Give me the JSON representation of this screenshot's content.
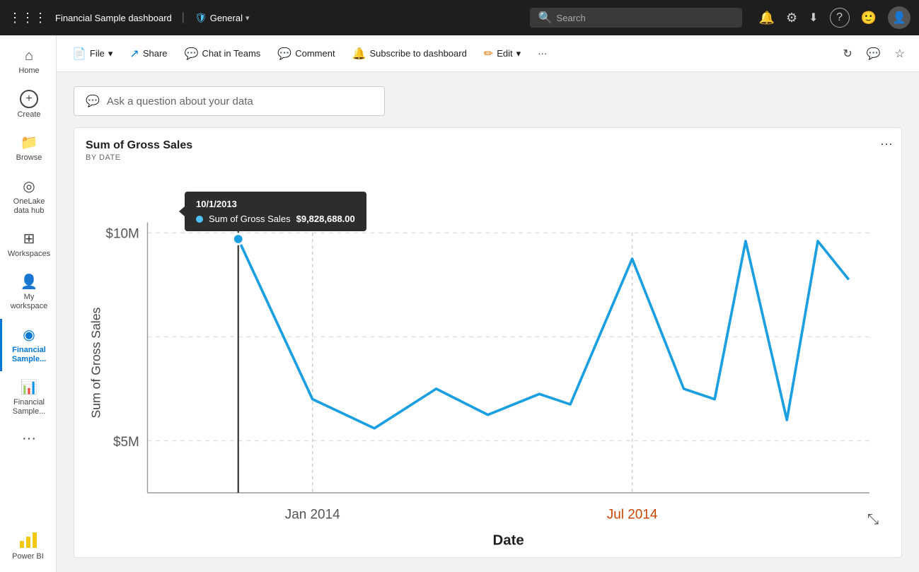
{
  "topnav": {
    "waffle": "⠿",
    "app_title": "Financial Sample  dashboard",
    "divider": "|",
    "workspace": "General",
    "search_placeholder": "Search",
    "icons": {
      "bell": "🔔",
      "gear": "⚙",
      "download": "⬇",
      "help": "?",
      "feedback": "🙂"
    }
  },
  "toolbar": {
    "file_label": "File",
    "share_label": "Share",
    "chat_label": "Chat in Teams",
    "comment_label": "Comment",
    "subscribe_label": "Subscribe to dashboard",
    "edit_label": "Edit",
    "more_label": "···",
    "refresh_label": "↻",
    "chat_icon_label": "💬",
    "star_label": "☆"
  },
  "qa": {
    "placeholder": "Ask a question about your data"
  },
  "chart": {
    "title": "Sum of Gross Sales",
    "subtitle": "BY DATE",
    "y_axis_label": "Sum of Gross Sales",
    "x_axis_label": "Date",
    "y_ticks": [
      "$10M",
      "$5M"
    ],
    "x_ticks": [
      "Jan 2014",
      "Jul 2014"
    ],
    "tooltip": {
      "date": "10/1/2013",
      "series_label": "Sum of Gross Sales",
      "value": "$9,828,688.00"
    }
  },
  "sidebar": {
    "items": [
      {
        "id": "home",
        "label": "Home",
        "icon": "⌂"
      },
      {
        "id": "create",
        "label": "Create",
        "icon": "+"
      },
      {
        "id": "browse",
        "label": "Browse",
        "icon": "📁"
      },
      {
        "id": "onelake",
        "label": "OneLake data hub",
        "icon": "◎"
      },
      {
        "id": "workspaces",
        "label": "Workspaces",
        "icon": "⊞"
      },
      {
        "id": "myworkspace",
        "label": "My workspace",
        "icon": "👤"
      },
      {
        "id": "financial-sample",
        "label": "Financial Sample...",
        "icon": "◉",
        "active": true
      },
      {
        "id": "financial-report",
        "label": "Financial Sample...",
        "icon": "📊"
      },
      {
        "id": "more",
        "label": "···",
        "icon": ""
      }
    ],
    "powerbi_label": "Power BI"
  }
}
